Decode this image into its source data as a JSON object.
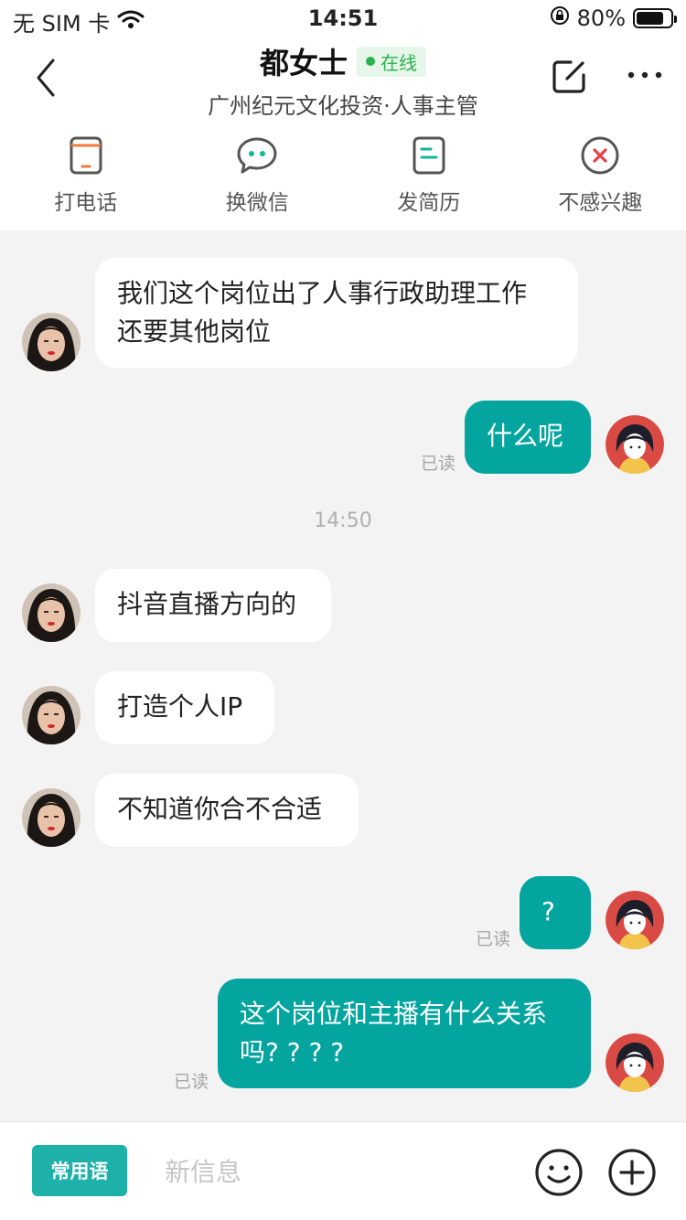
{
  "status_bar": {
    "carrier": "无 SIM 卡",
    "time": "14:51",
    "battery_percent": "80%",
    "battery_level": 0.8
  },
  "header": {
    "name": "都女士",
    "status": "在线",
    "subtitle": "广州纪元文化投资·人事主管",
    "icons": [
      "back-icon",
      "edit-icon",
      "more-icon"
    ]
  },
  "actions": [
    {
      "label": "打电话",
      "icon": "phone-icon"
    },
    {
      "label": "换微信",
      "icon": "wechat-icon"
    },
    {
      "label": "发简历",
      "icon": "resume-icon"
    },
    {
      "label": "不感兴趣",
      "icon": "not-interested-icon"
    }
  ],
  "chat": {
    "messages": [
      {
        "dir": "in",
        "lines": [
          "我们这个岗位出了人事行政助理工作",
          "还要其他岗位"
        ]
      },
      {
        "dir": "out",
        "lines": [
          "什么呢"
        ],
        "read": "已读"
      },
      {
        "dir": "in",
        "lines": [
          "抖音直播方向的"
        ]
      },
      {
        "dir": "in",
        "lines": [
          "打造个人IP"
        ]
      },
      {
        "dir": "in",
        "lines": [
          "不知道你合不合适"
        ]
      },
      {
        "dir": "out",
        "lines": [
          "?"
        ],
        "read": "已读"
      },
      {
        "dir": "out",
        "lines": [
          "这个岗位和主播有什么关系",
          "吗? ? ? ?"
        ],
        "read": "已读"
      }
    ],
    "timestamp": "14:50"
  },
  "input_bar": {
    "phrase_button": "常用语",
    "placeholder": "新信息",
    "icons": [
      "emoji-icon",
      "plus-icon"
    ]
  },
  "colors": {
    "accent": "#05a59f",
    "phrase_button": "#1db1aa",
    "online": "#2bb24c",
    "call_icon": "#f07b3f",
    "reject_icon": "#e5414a"
  }
}
